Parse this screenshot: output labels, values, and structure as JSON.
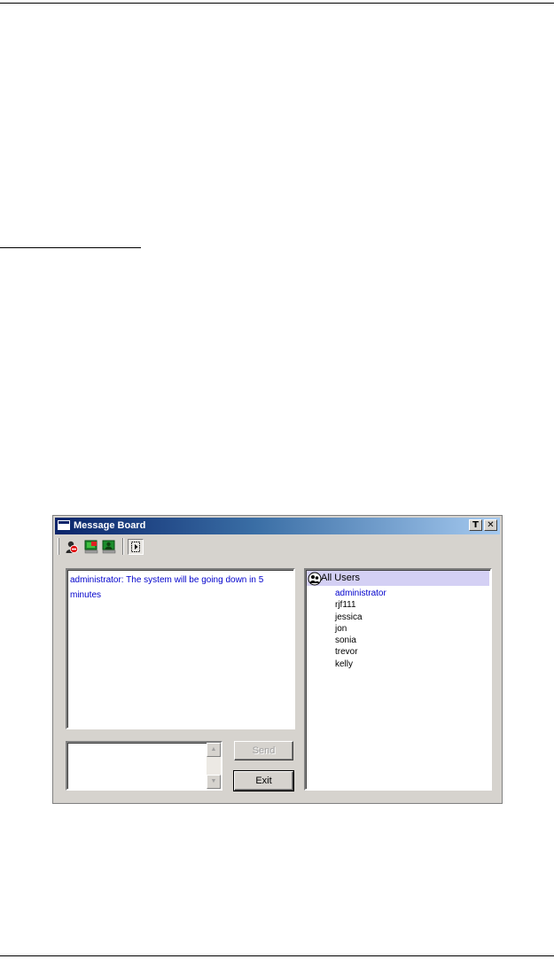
{
  "window": {
    "title": "Message Board",
    "title_buttons": [
      "T",
      "✕"
    ]
  },
  "toolbar": {
    "icons": [
      "block-user-icon",
      "broadcast-icon",
      "public-chat-icon",
      "collapse-panel-icon"
    ]
  },
  "messages": [
    "administrator: The system will be going down in 5 minutes"
  ],
  "compose": {
    "value": "",
    "send_label": "Send",
    "exit_label": "Exit"
  },
  "users_panel": {
    "header": "All Users",
    "users": [
      "administrator",
      "rjf111",
      "jessica",
      "jon",
      "sonia",
      "trevor",
      "kelly"
    ]
  },
  "colors": {
    "message_text": "#0000cc",
    "title_gradient_start": "#0a246a",
    "title_gradient_end": "#a6caf0",
    "users_header_bg": "#d4d0f4"
  }
}
